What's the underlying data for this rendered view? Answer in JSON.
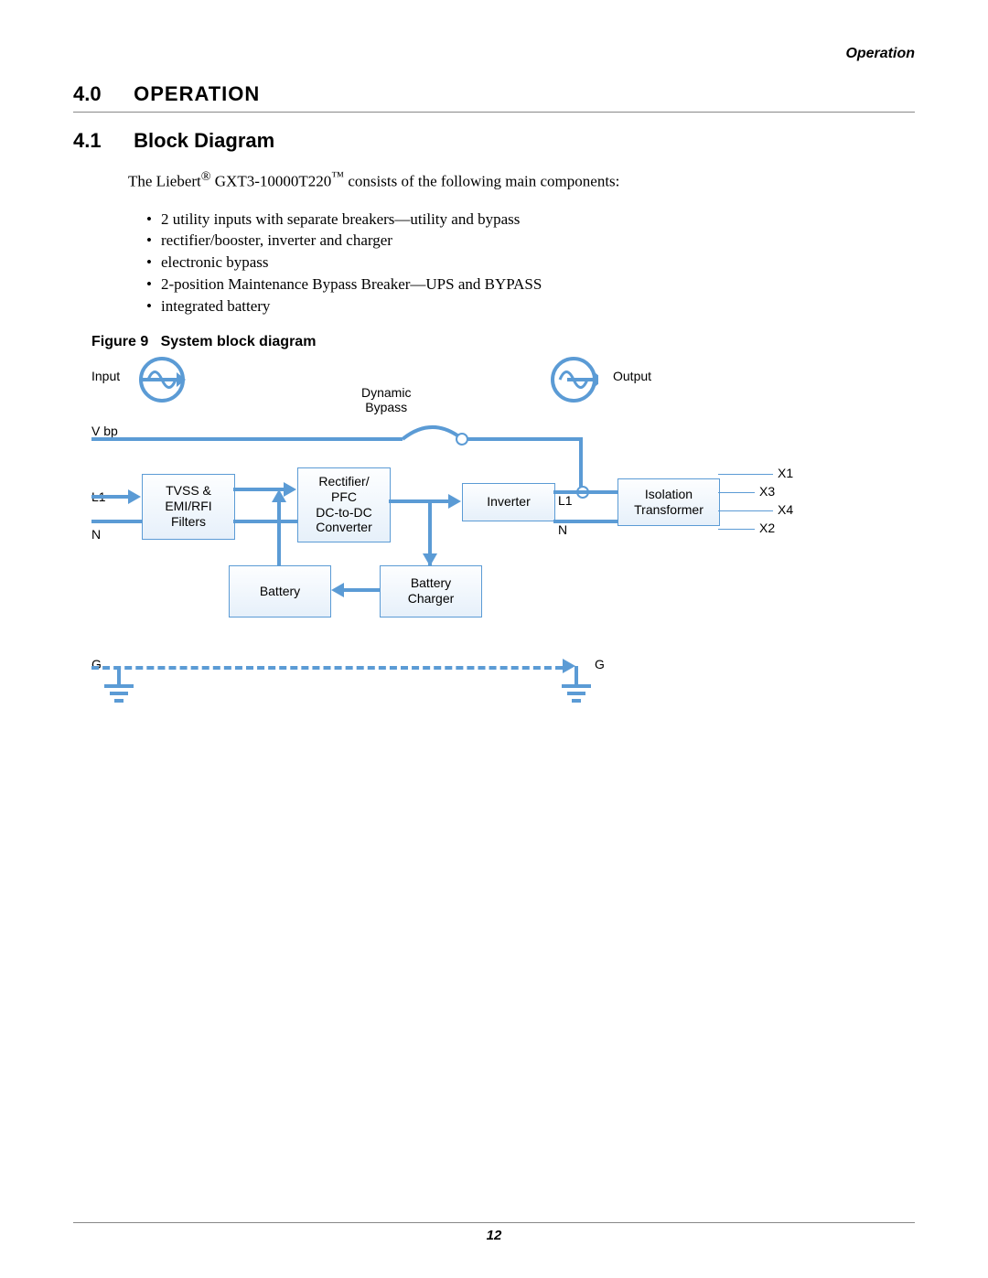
{
  "header": {
    "running": "Operation"
  },
  "section": {
    "number": "4.0",
    "title": "OPERATION"
  },
  "subsection": {
    "number": "4.1",
    "title": "Block Diagram"
  },
  "intro": {
    "prefix": "The Liebert",
    "reg": "®",
    "model_prefix": " GXT3-10000T220",
    "tm": "™",
    "suffix": " consists of the following main components:"
  },
  "bullets": [
    "2 utility inputs with separate breakers—utility and bypass",
    "rectifier/booster, inverter and charger",
    "electronic bypass",
    "2-position Maintenance Bypass Breaker—UPS and BYPASS",
    "integrated battery"
  ],
  "figure": {
    "label": "Figure 9",
    "title": "System block diagram",
    "labels": {
      "input": "Input",
      "output": "Output",
      "dynamic_bypass": "Dynamic\nBypass",
      "vbp": "V bp",
      "l1_left": "L1",
      "n_left": "N",
      "l1_right": "L1",
      "n_right": "N",
      "g_left": "G",
      "g_right": "G",
      "x1": "X1",
      "x2": "X2",
      "x3": "X3",
      "x4": "X4"
    },
    "blocks": {
      "filters": "TVSS &\nEMI/RFI\nFilters",
      "rectifier": "Rectifier/\nPFC\nDC-to-DC\nConverter",
      "inverter": "Inverter",
      "iso": "Isolation\nTransformer",
      "battery": "Battery",
      "charger": "Battery\nCharger"
    }
  },
  "footer": {
    "page": "12"
  }
}
